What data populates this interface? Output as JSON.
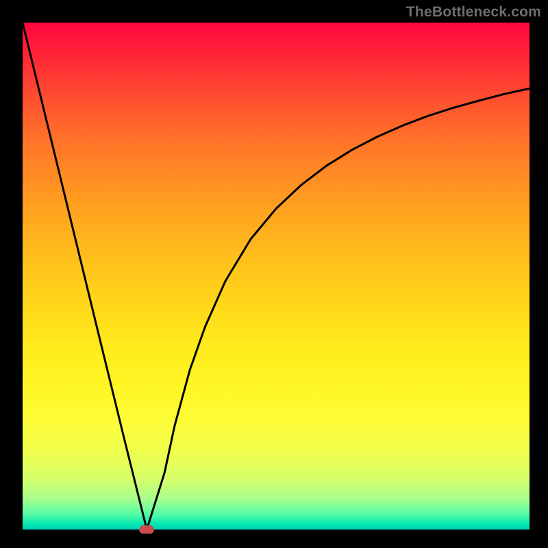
{
  "watermark": "TheBottleneck.com",
  "chart_data": {
    "type": "line",
    "title": "",
    "xlabel": "",
    "ylabel": "",
    "xlim": [
      0,
      100
    ],
    "ylim": [
      0,
      100
    ],
    "background_gradient": {
      "top_color": "#ff073f",
      "mid_color": "#ffea1c",
      "bottom_color": "#00d2b9"
    },
    "series": [
      {
        "name": "curve",
        "x": [
          0,
          5,
          10,
          15,
          20,
          24.5,
          28,
          30,
          33,
          36,
          40,
          45,
          50,
          55,
          60,
          65,
          70,
          75,
          80,
          85,
          90,
          95,
          100
        ],
        "values": [
          100,
          79.5,
          59.0,
          38.5,
          18.1,
          0,
          11.2,
          20.5,
          31.5,
          40.0,
          49.0,
          57.3,
          63.3,
          68.0,
          71.8,
          74.9,
          77.5,
          79.7,
          81.6,
          83.2,
          84.6,
          85.9,
          87.0
        ]
      }
    ],
    "marker": {
      "x": 24.5,
      "y": 0,
      "color": "#c94a4f"
    }
  }
}
